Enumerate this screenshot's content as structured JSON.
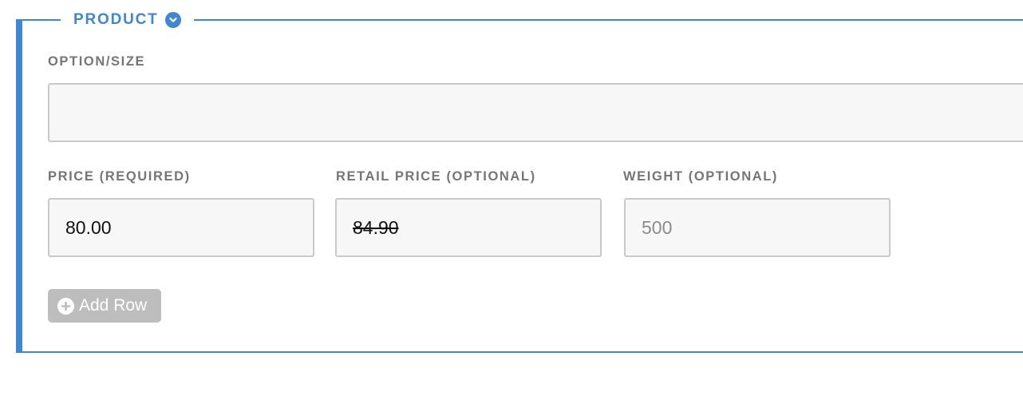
{
  "section": {
    "title": "PRODUCT",
    "toggle_icon": "chevron-down-circle-icon",
    "accent_color": "#3f86d3"
  },
  "fields": {
    "option_size": {
      "label": "OPTION/SIZE",
      "value": ""
    },
    "price": {
      "label": "PRICE (REQUIRED)",
      "value": "80.00"
    },
    "retail_price": {
      "label": "RETAIL PRICE (OPTIONAL)",
      "value": "84.90"
    },
    "weight": {
      "label": "WEIGHT (OPTIONAL)",
      "placeholder": "500"
    }
  },
  "actions": {
    "add_row_label": "Add Row",
    "add_row_icon": "plus-circle-icon"
  }
}
